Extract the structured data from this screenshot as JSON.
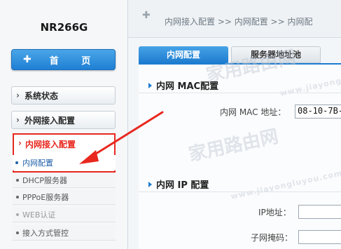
{
  "sidebar": {
    "brand": "NR266G",
    "home_label": "首 页",
    "home_icon": "plus-icon",
    "items": [
      {
        "label": "系统状态"
      },
      {
        "label": "外网接入配置"
      },
      {
        "label": "内网接入配置"
      }
    ],
    "sub_items": [
      {
        "label": "内网配置"
      },
      {
        "label": "DHCP服务器"
      },
      {
        "label": "PPPoE服务器"
      },
      {
        "label": "WEB认证"
      },
      {
        "label": "接入方式管控"
      }
    ]
  },
  "breadcrumb": "内网接入配置 >> 内网配置 >> 内网配",
  "tabs": [
    {
      "label": "内网配置",
      "active": true
    },
    {
      "label": "服务器地址池",
      "active": false
    }
  ],
  "mac_section": {
    "title": "内网 MAC配置",
    "mac_label": "内网 MAC 地址：",
    "mac_value": "08-10-7B-"
  },
  "ip_section": {
    "title": "内网 IP 配置",
    "ip_label": "IP地址：",
    "ip_value": "",
    "mask_label": "子网掩码：",
    "mask_value": ""
  },
  "watermark": {
    "text": "家用路由网",
    "url": "www.jiayongluyou.com"
  },
  "colors": {
    "accent": "#1e7cd0",
    "highlight": "#e8281f"
  }
}
